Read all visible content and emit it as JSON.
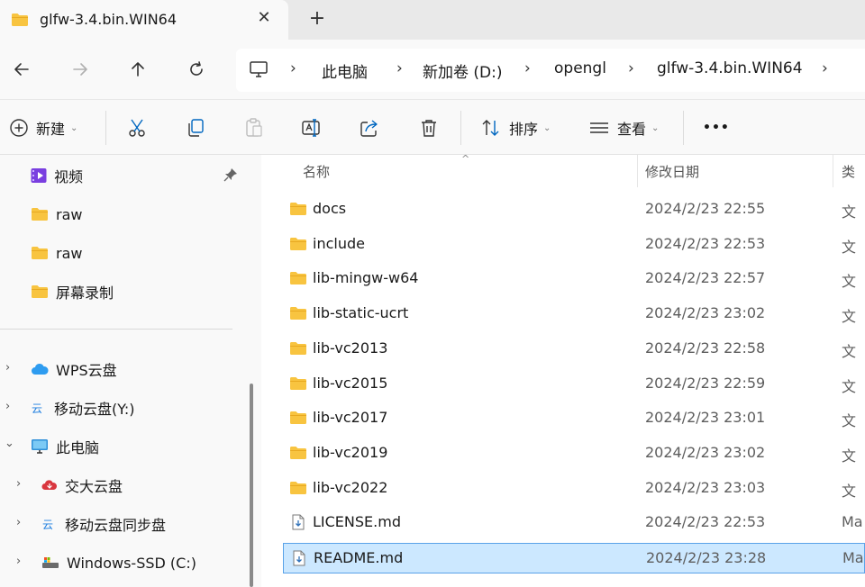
{
  "window": {
    "tab_title": "glfw-3.4.bin.WIN64",
    "close_glyph": "✕",
    "new_tab_glyph": "+"
  },
  "nav": {
    "back_icon": "arrow-left-icon",
    "forward_icon": "arrow-right-icon",
    "up_icon": "arrow-up-icon",
    "refresh_icon": "refresh-icon"
  },
  "breadcrumb": {
    "items": [
      "此电脑",
      "新加卷 (D:)",
      "opengl",
      "glfw-3.4.bin.WIN64"
    ],
    "separator": "›"
  },
  "toolbar": {
    "new_label": "新建",
    "sort_label": "排序",
    "view_label": "查看",
    "more_glyph": "•••",
    "chevron": "⌄"
  },
  "sidebar": {
    "quick_items": [
      {
        "label": "视频",
        "icon": "video-folder-icon",
        "pinned": true
      },
      {
        "label": "raw",
        "icon": "folder-icon"
      },
      {
        "label": "raw",
        "icon": "folder-icon"
      },
      {
        "label": "屏幕录制",
        "icon": "folder-icon"
      }
    ],
    "tree_items": [
      {
        "label": "WPS云盘",
        "icon": "cloud-icon",
        "expander": "›"
      },
      {
        "label": "移动云盘(Y:)",
        "icon": "mobile-cloud-icon",
        "expander": "›"
      },
      {
        "label": "此电脑",
        "icon": "computer-icon",
        "expander": "⌄"
      },
      {
        "label": "交大云盘",
        "icon": "red-cloud-icon",
        "expander": "›"
      },
      {
        "label": "移动云盘同步盘",
        "icon": "mobile-cloud-icon",
        "expander": "›"
      },
      {
        "label": "Windows-SSD (C:)",
        "icon": "drive-icon",
        "expander": "›"
      }
    ]
  },
  "columns": {
    "name": "名称",
    "date": "修改日期",
    "type": "类"
  },
  "files": [
    {
      "name": "docs",
      "date": "2024/2/23 22:55",
      "type": "文",
      "kind": "folder"
    },
    {
      "name": "include",
      "date": "2024/2/23 22:53",
      "type": "文",
      "kind": "folder"
    },
    {
      "name": "lib-mingw-w64",
      "date": "2024/2/23 22:57",
      "type": "文",
      "kind": "folder"
    },
    {
      "name": "lib-static-ucrt",
      "date": "2024/2/23 23:02",
      "type": "文",
      "kind": "folder"
    },
    {
      "name": "lib-vc2013",
      "date": "2024/2/23 22:58",
      "type": "文",
      "kind": "folder"
    },
    {
      "name": "lib-vc2015",
      "date": "2024/2/23 22:59",
      "type": "文",
      "kind": "folder"
    },
    {
      "name": "lib-vc2017",
      "date": "2024/2/23 23:01",
      "type": "文",
      "kind": "folder"
    },
    {
      "name": "lib-vc2019",
      "date": "2024/2/23 23:02",
      "type": "文",
      "kind": "folder"
    },
    {
      "name": "lib-vc2022",
      "date": "2024/2/23 23:03",
      "type": "文",
      "kind": "folder"
    },
    {
      "name": "LICENSE.md",
      "date": "2024/2/23 22:53",
      "type": "Ma",
      "kind": "file"
    },
    {
      "name": "README.md",
      "date": "2024/2/23 23:28",
      "type": "Ma",
      "kind": "file",
      "selected": true
    }
  ],
  "colors": {
    "folder": "#f8c440",
    "selection_bg": "#cce8ff",
    "selection_border": "#5aa2e8",
    "accent": "#0067c0"
  }
}
